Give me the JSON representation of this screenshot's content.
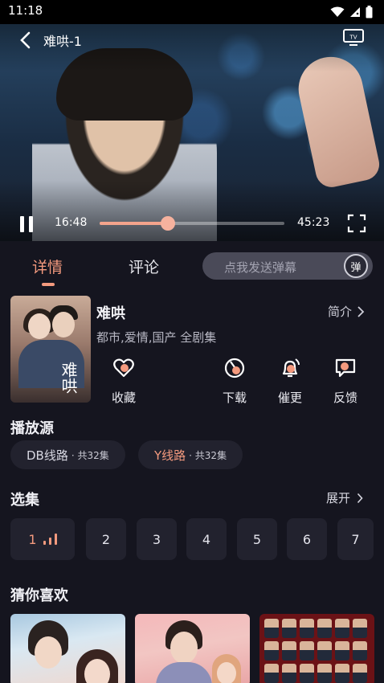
{
  "status_bar": {
    "time": "11:18"
  },
  "player": {
    "title": "难哄-1",
    "current_time": "16:48",
    "total_time": "45:23",
    "progress": 0.37
  },
  "tabs": [
    {
      "label": "详情"
    },
    {
      "label": "评论"
    }
  ],
  "danmaku": {
    "placeholder": "点我发送弹幕",
    "icon_text": "弹"
  },
  "show": {
    "title": "难哄",
    "tags": "都市,爱情,国产 全剧集",
    "intro_label": "简介",
    "poster_text": "难哄"
  },
  "actions": [
    {
      "label": "收藏",
      "icon": "heart-icon"
    },
    {
      "label": "下载",
      "icon": "download-icon"
    },
    {
      "label": "催更",
      "icon": "bell-icon"
    },
    {
      "label": "反馈",
      "icon": "feedback-icon"
    }
  ],
  "sources": {
    "title": "播放源",
    "items": [
      {
        "name": "DB线路",
        "count": "· 共32集"
      },
      {
        "name": "Y线路",
        "count": "· 共32集"
      }
    ]
  },
  "episodes": {
    "title": "选集",
    "expand_label": "展开",
    "items": [
      "1",
      "2",
      "3",
      "4",
      "5",
      "6",
      "7"
    ]
  },
  "recommend": {
    "title": "猜你喜欢"
  },
  "colors": {
    "accent": "#f49a7e",
    "background": "#15151f",
    "card": "#22222e"
  }
}
